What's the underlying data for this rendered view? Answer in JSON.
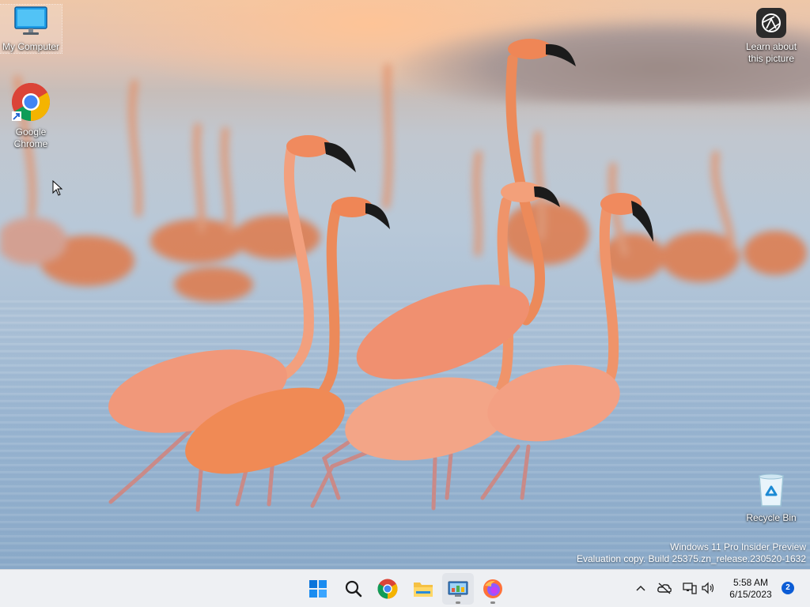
{
  "desktop": {
    "icons": [
      {
        "label": "My Computer",
        "icon": "monitor-icon"
      },
      {
        "label": "Google Chrome",
        "icon": "chrome-icon"
      },
      {
        "label": "Recycle Bin",
        "icon": "recycle-bin-icon"
      }
    ],
    "learn_about": {
      "line1": "Learn about",
      "line2": "this picture",
      "icon": "camera-lens-icon"
    },
    "watermark": {
      "line1": "Windows 11 Pro Insider Preview",
      "line2": "Evaluation copy. Build 25375.zn_release.230520-1632"
    },
    "wallpaper": "Flamingos wading in water at sunset"
  },
  "taskbar": {
    "apps": [
      {
        "name": "Start",
        "icon": "windows-start-icon"
      },
      {
        "name": "Search",
        "icon": "search-icon"
      },
      {
        "name": "Google Chrome",
        "icon": "chrome-icon"
      },
      {
        "name": "File Explorer",
        "icon": "folder-icon"
      },
      {
        "name": "Control Panel",
        "icon": "control-panel-icon",
        "running": true
      },
      {
        "name": "Firefox",
        "icon": "firefox-icon",
        "running": true
      }
    ],
    "tray": {
      "icons": [
        "chevron-up-icon",
        "onedrive-offline-icon",
        "network-icon",
        "volume-icon"
      ],
      "time": "5:58 AM",
      "date": "6/15/2023",
      "notification_count": "2"
    }
  },
  "colors": {
    "taskbar_bg": "#eef0f3",
    "badge": "#0b5cd5",
    "accent": "#0078d4"
  }
}
